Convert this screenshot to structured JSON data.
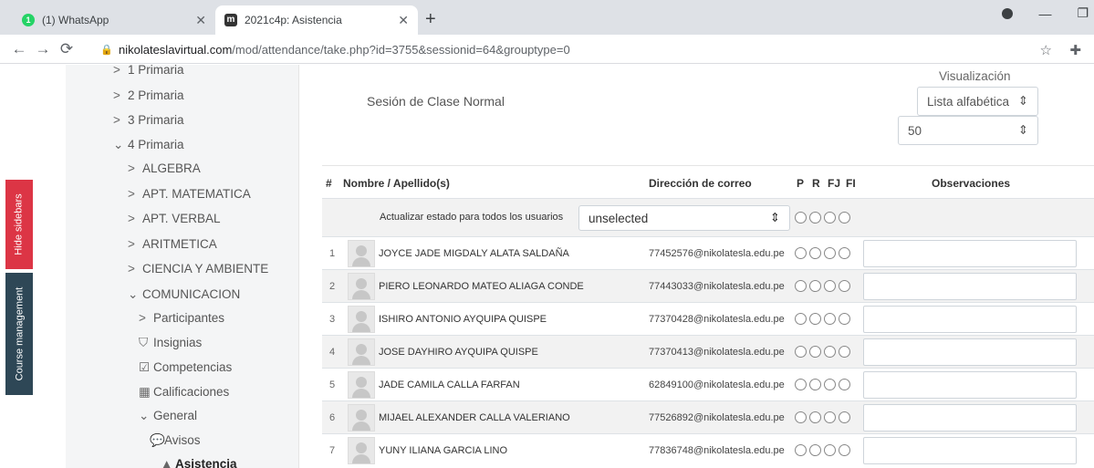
{
  "browser": {
    "tabs": [
      {
        "label": "(1) WhatsApp",
        "icon": "whatsapp-icon",
        "badge": "1"
      },
      {
        "label": "2021c4p: Asistencia",
        "icon": "moodle-icon",
        "badge": "m"
      }
    ],
    "url_host": "nikolateslavirtual.com",
    "url_path": "/mod/attendance/take.php?id=3755&sessionid=64&grouptype=0"
  },
  "side_buttons": {
    "hide_sidebars": "Hide sidebars",
    "course_management": "Course management"
  },
  "nav": {
    "items": [
      {
        "label": "1 Primaria",
        "prefix": ">"
      },
      {
        "label": "2 Primaria",
        "prefix": ">"
      },
      {
        "label": "3 Primaria",
        "prefix": ">"
      },
      {
        "label": "4 Primaria",
        "prefix": "⌄"
      },
      {
        "label": "ALGEBRA",
        "prefix": ">"
      },
      {
        "label": "APT. MATEMATICA",
        "prefix": ">"
      },
      {
        "label": "APT. VERBAL",
        "prefix": ">"
      },
      {
        "label": "ARITMETICA",
        "prefix": ">"
      },
      {
        "label": "CIENCIA Y AMBIENTE",
        "prefix": ">"
      },
      {
        "label": "COMUNICACION",
        "prefix": "⌄"
      },
      {
        "label": "Participantes",
        "prefix": ">"
      },
      {
        "label": "Insignias",
        "prefix": "⛉"
      },
      {
        "label": "Competencias",
        "prefix": "☑"
      },
      {
        "label": "Calificaciones",
        "prefix": "▦"
      },
      {
        "label": "General",
        "prefix": "⌄"
      },
      {
        "label": "Avisos",
        "prefix": "💬"
      },
      {
        "label": "Asistencia",
        "prefix": "▲"
      }
    ]
  },
  "main": {
    "session_description": "Sesión de Clase Normal",
    "view_label": "Visualización",
    "view_select": "Lista alfabética",
    "per_page": "50",
    "headers": {
      "num": "#",
      "name": "Nombre / Apellido(s)",
      "email": "Dirección de correo",
      "p": "P",
      "r": "R",
      "fj": "FJ",
      "fi": "FI",
      "observations": "Observaciones"
    },
    "bulk_label": "Actualizar estado para todos los usuarios",
    "bulk_select": "unselected",
    "students": [
      {
        "n": "1",
        "name": "JOYCE JADE MIGDALY ALATA SALDAÑA",
        "email": "77452576@nikolatesla.edu.pe"
      },
      {
        "n": "2",
        "name": "PIERO LEONARDO MATEO ALIAGA CONDE",
        "email": "77443033@nikolatesla.edu.pe"
      },
      {
        "n": "3",
        "name": "ISHIRO ANTONIO AYQUIPA QUISPE",
        "email": "77370428@nikolatesla.edu.pe"
      },
      {
        "n": "4",
        "name": "JOSE DAYHIRO AYQUIPA QUISPE",
        "email": "77370413@nikolatesla.edu.pe"
      },
      {
        "n": "5",
        "name": "JADE CAMILA CALLA FARFAN",
        "email": "62849100@nikolatesla.edu.pe"
      },
      {
        "n": "6",
        "name": "MIJAEL ALEXANDER CALLA VALERIANO",
        "email": "77526892@nikolatesla.edu.pe"
      },
      {
        "n": "7",
        "name": "YUNY ILIANA GARCIA LINO",
        "email": "77836748@nikolatesla.edu.pe"
      }
    ]
  }
}
